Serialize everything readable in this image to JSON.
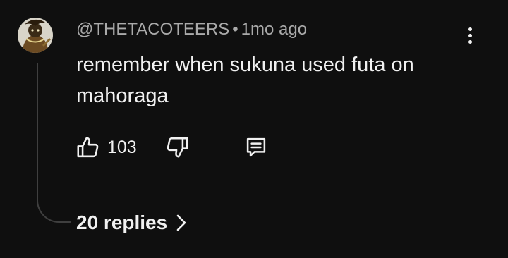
{
  "comment": {
    "author": "@THETACOTEERS",
    "separator": "•",
    "time": "1mo ago",
    "text": "remember when sukuna used futa on mahoraga",
    "like_count": "103"
  },
  "replies": {
    "label": "20 replies"
  },
  "icons": {
    "like": "thumbs-up-icon",
    "dislike": "thumbs-down-icon",
    "reply": "comment-icon",
    "menu": "more-vert-icon",
    "replies_chevron": "chevron-right-icon"
  },
  "colors": {
    "background": "#0f0f0f",
    "text_primary": "#f1f1f1",
    "text_secondary": "#aaaaaa",
    "thread_line": "#3f3f3f"
  }
}
